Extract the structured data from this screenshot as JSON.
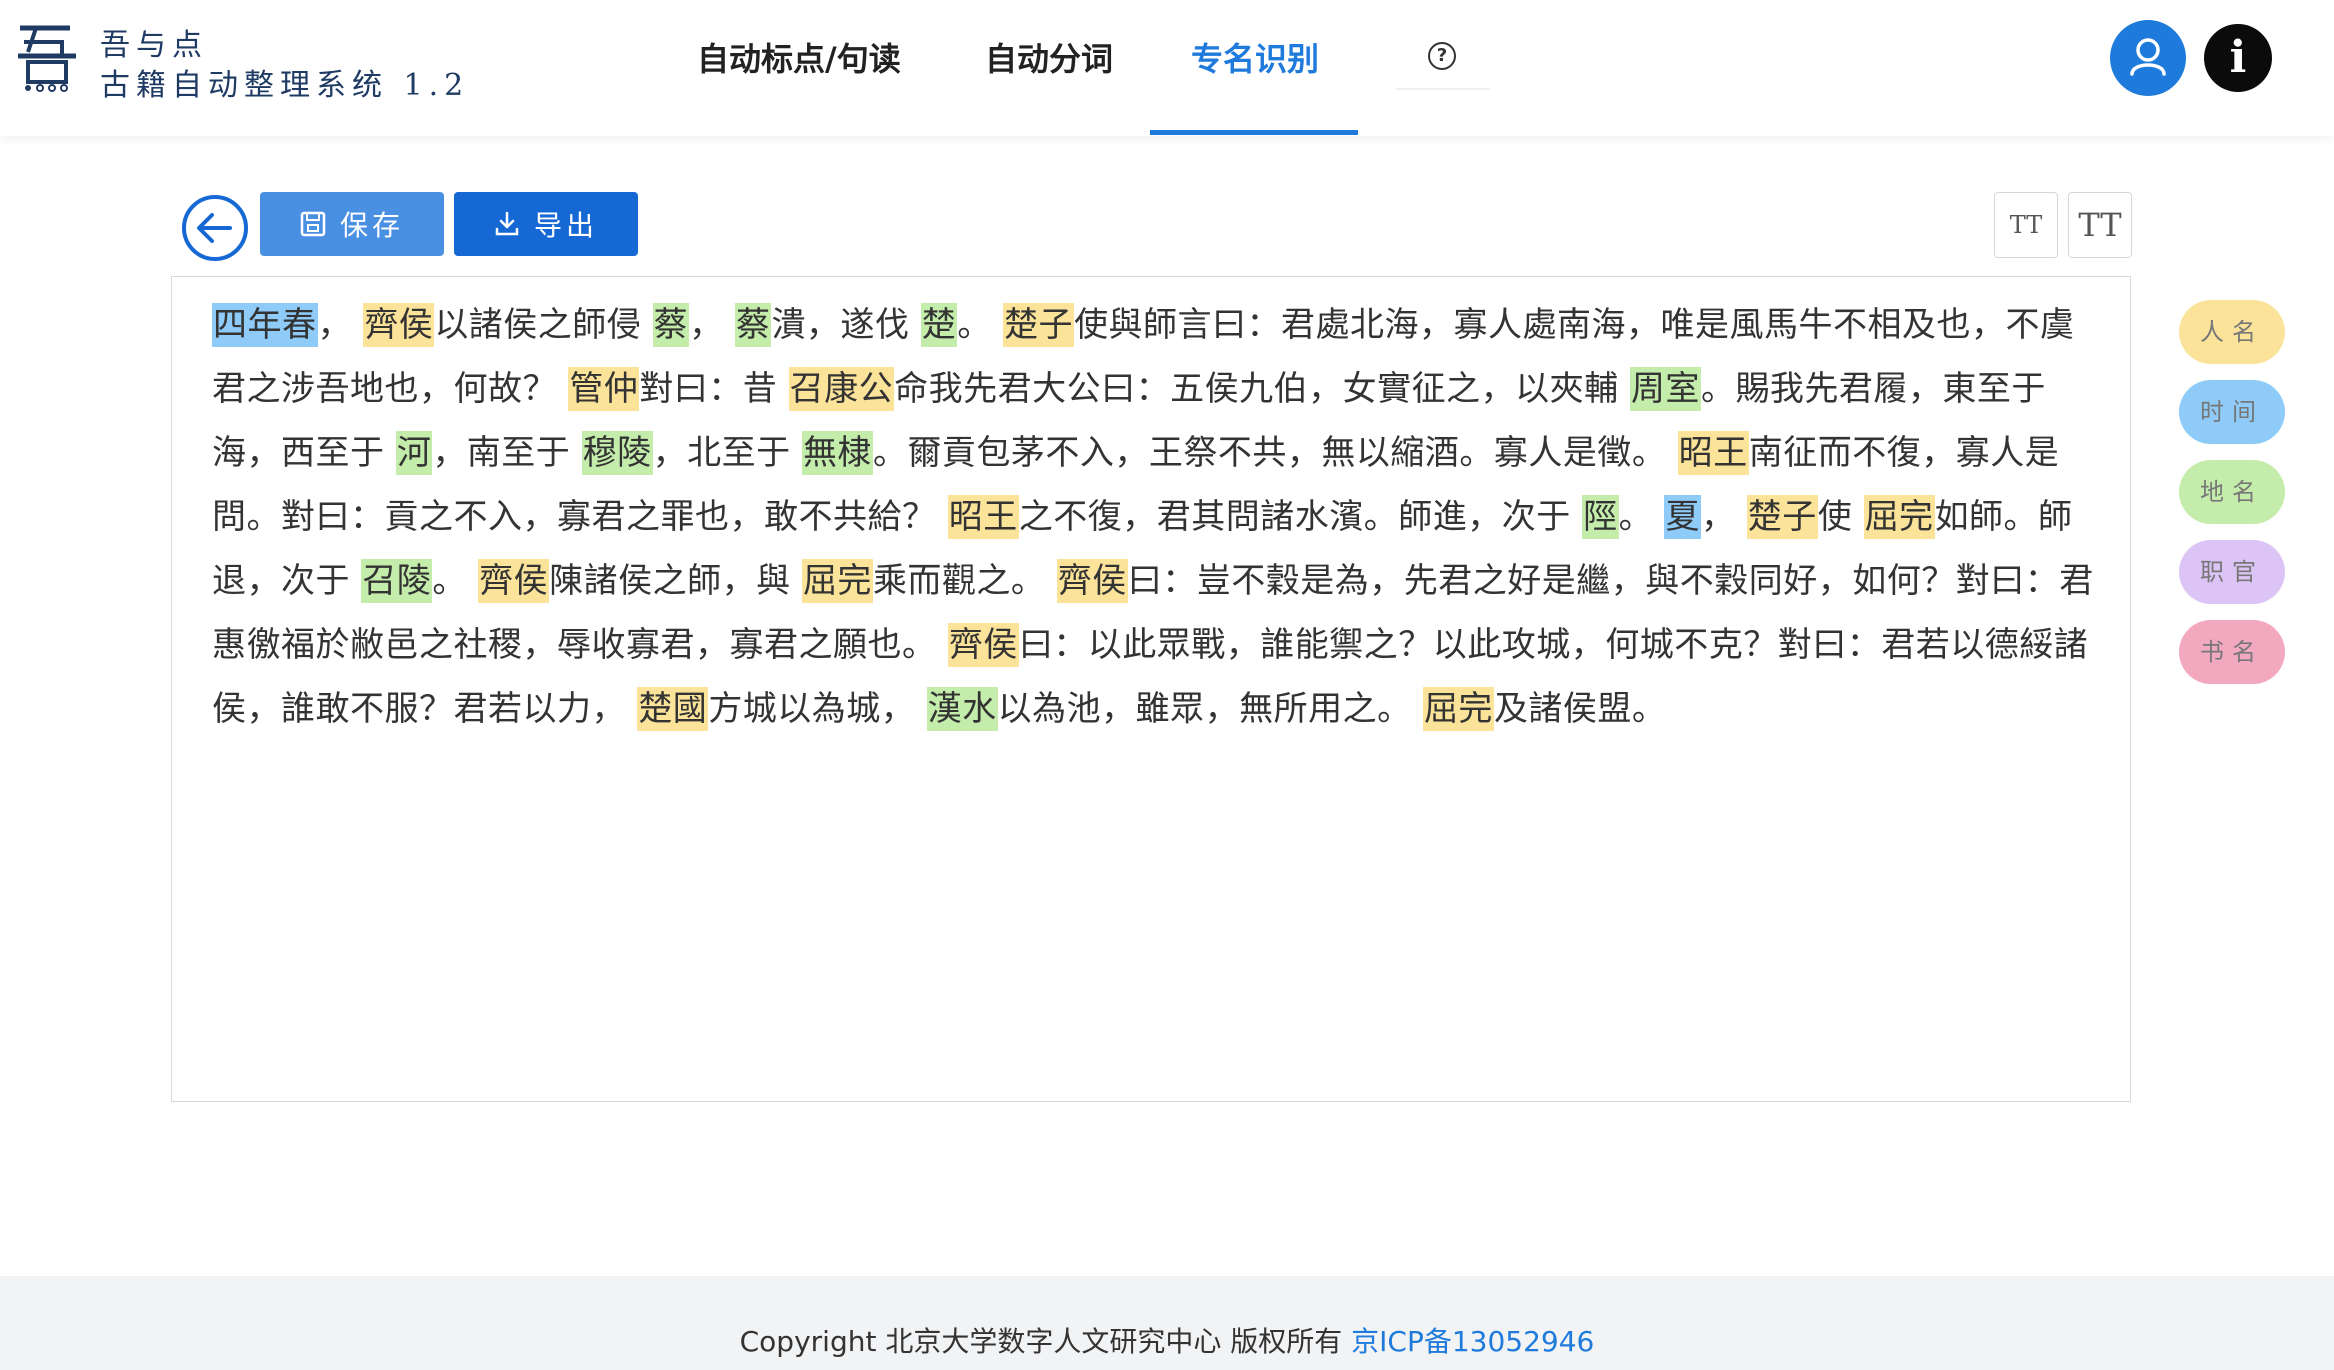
{
  "app": {
    "name": "吾与点",
    "subtitle": "古籍自动整理系统 1.2"
  },
  "nav": {
    "tabs": [
      {
        "label": "自动标点/句读"
      },
      {
        "label": "自动分词"
      },
      {
        "label": "专名识别"
      }
    ],
    "active_tab": "专名识别",
    "help_icon": "question-circle-icon",
    "user_icon": "user-icon",
    "info_icon": "info-icon"
  },
  "toolbar": {
    "back_icon": "arrow-left-circle-icon",
    "save_label": "保存",
    "export_label": "导出",
    "font_decrease_label": "TT",
    "font_increase_label": "TT"
  },
  "entity_colors": {
    "person": "#fbe39a",
    "time": "#8ecbf8",
    "place": "#c4ecaa",
    "office": "#dcc4f6",
    "book": "#f2a9c0"
  },
  "legend": [
    {
      "label": "人名",
      "type": "person",
      "color": "#fbe39a"
    },
    {
      "label": "时间",
      "type": "time",
      "color": "#8ecbf8"
    },
    {
      "label": "地名",
      "type": "place",
      "color": "#c4ecaa"
    },
    {
      "label": "职官",
      "type": "office",
      "color": "#dcc4f6"
    },
    {
      "label": "书名",
      "type": "book",
      "color": "#f2a9c0"
    }
  ],
  "text_segments": [
    {
      "t": "四年春",
      "e": "time"
    },
    {
      "t": "， "
    },
    {
      "t": "齊侯",
      "e": "person"
    },
    {
      "t": "以諸侯之師侵 "
    },
    {
      "t": "蔡",
      "e": "place"
    },
    {
      "t": "， "
    },
    {
      "t": "蔡",
      "e": "place"
    },
    {
      "t": "潰，遂伐 "
    },
    {
      "t": "楚",
      "e": "place"
    },
    {
      "t": "。 "
    },
    {
      "t": "楚子",
      "e": "person"
    },
    {
      "t": "使與師言曰：君處北海，寡人處南海，唯是風馬牛不相及也，不虞君之涉吾地也，何故？ "
    },
    {
      "t": "管仲",
      "e": "person"
    },
    {
      "t": "對曰：昔 "
    },
    {
      "t": "召康公",
      "e": "person"
    },
    {
      "t": "命我先君大公曰：五侯九伯，女實征之，以夾輔 "
    },
    {
      "t": "周室",
      "e": "place"
    },
    {
      "t": "。賜我先君履，東至于海，西至于 "
    },
    {
      "t": "河",
      "e": "place"
    },
    {
      "t": "，南至于 "
    },
    {
      "t": "穆陵",
      "e": "place"
    },
    {
      "t": "，北至于 "
    },
    {
      "t": "無棣",
      "e": "place"
    },
    {
      "t": "。爾貢包茅不入，王祭不共，無以縮酒。寡人是徵。 "
    },
    {
      "t": "昭王",
      "e": "person"
    },
    {
      "t": "南征而不復，寡人是問。對曰：貢之不入，寡君之罪也，敢不共給？ "
    },
    {
      "t": "昭王",
      "e": "person"
    },
    {
      "t": "之不復，君其問諸水濱。師進，次于 "
    },
    {
      "t": "陘",
      "e": "place"
    },
    {
      "t": "。 "
    },
    {
      "t": "夏",
      "e": "time"
    },
    {
      "t": "， "
    },
    {
      "t": "楚子",
      "e": "person"
    },
    {
      "t": "使 "
    },
    {
      "t": "屈完",
      "e": "person"
    },
    {
      "t": "如師。師退，次于 "
    },
    {
      "t": "召陵",
      "e": "place"
    },
    {
      "t": "。 "
    },
    {
      "t": "齊侯",
      "e": "person"
    },
    {
      "t": "陳諸侯之師，與 "
    },
    {
      "t": "屈完",
      "e": "person"
    },
    {
      "t": "乘而觀之。 "
    },
    {
      "t": "齊侯",
      "e": "person"
    },
    {
      "t": "曰：豈不穀是為，先君之好是繼，與不穀同好，如何？對曰：君惠徼福於敝邑之社稷，辱收寡君，寡君之願也。 "
    },
    {
      "t": "齊侯",
      "e": "person"
    },
    {
      "t": "曰：以此眾戰，誰能禦之？以此攻城，何城不克？對曰：君若以德綏諸侯，誰敢不服？君若以力， "
    },
    {
      "t": "楚國",
      "e": "person"
    },
    {
      "t": "方城以為城， "
    },
    {
      "t": "漢水",
      "e": "place"
    },
    {
      "t": "以為池，雖眾，無所用之。 "
    },
    {
      "t": "屈完",
      "e": "person"
    },
    {
      "t": "及諸侯盟。"
    }
  ],
  "footer": {
    "copyright": "Copyright 北京大学数字人文研究中心 版权所有 ",
    "icp": "京ICP备13052946"
  }
}
